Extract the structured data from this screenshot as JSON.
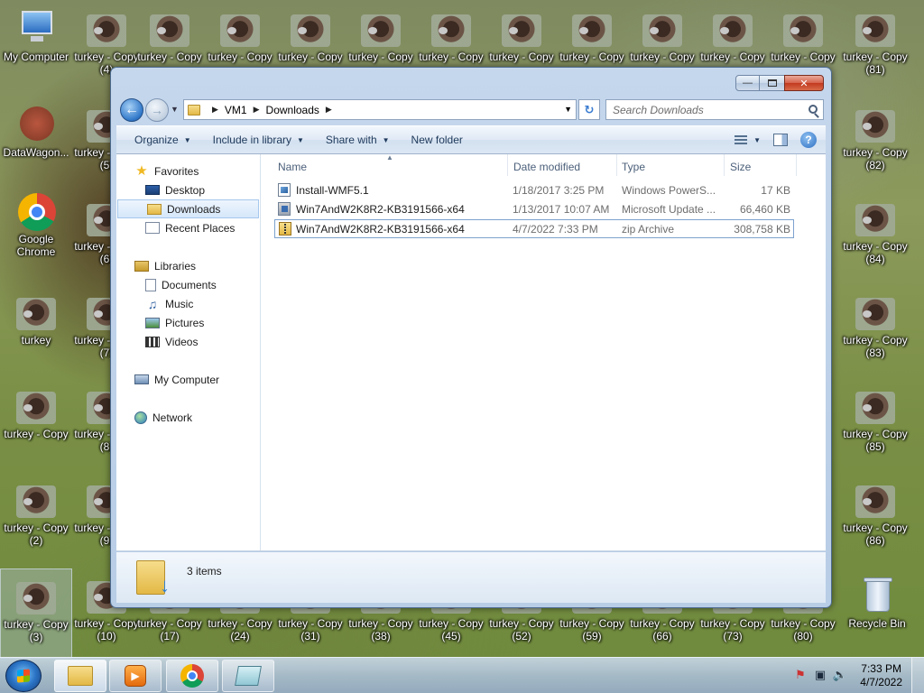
{
  "desktop": {
    "icons": [
      {
        "label": "My Computer",
        "icon": "computer-icon",
        "name": "desktop-icon-my-computer"
      },
      {
        "label": "DataWagon...",
        "icon": "datawagon-icon",
        "name": "desktop-icon-datawagon"
      },
      {
        "label": "Google Chrome",
        "icon": "chrome-icon",
        "name": "desktop-icon-google-chrome"
      },
      {
        "label": "turkey",
        "icon": "turkey-image-icon",
        "name": "desktop-icon-turkey"
      },
      {
        "label": "turkey - Copy (2)",
        "icon": "turkey-image-icon",
        "name": "desktop-icon-turkey-copy-2"
      },
      {
        "label": "turkey - Copy (3)",
        "icon": "turkey-image-icon",
        "name": "desktop-icon-turkey-copy-3"
      },
      {
        "label": "Recycle Bin",
        "icon": "recycle-bin-icon",
        "name": "desktop-icon-recycle-bin"
      }
    ],
    "turkey_copy_labels": {
      "top_row": [
        "turkey - Copy (4)",
        "turkey - Copy",
        "turkey - Copy",
        "turkey - Copy",
        "turkey - Copy",
        "turkey - Copy",
        "turkey - Copy",
        "turkey - Copy",
        "turkey - Copy",
        "turkey - Copy",
        "turkey - Copy",
        "turkey - Copy (81)",
        "turkey - Copy"
      ],
      "column_two": [
        "turkey - Copy (5)",
        "turkey - Copy (6)",
        "turkey - Copy (7)",
        "turkey - Copy (8)",
        "turkey - Copy (9)",
        "turkey - Copy (10)"
      ],
      "right_column": [
        "turkey - Copy (82)",
        "turkey - Copy (84)",
        "turkey - Copy (83)",
        "turkey - Copy (85)",
        "turkey - Copy (86)"
      ],
      "bottom_row": [
        "turkey - Copy (17)",
        "turkey - Copy (24)",
        "turkey - Copy (31)",
        "turkey - Copy (38)",
        "turkey - Copy (45)",
        "turkey - Copy (52)",
        "turkey - Copy (59)",
        "turkey - Copy (66)",
        "turkey - Copy (73)",
        "turkey - Copy (80)"
      ],
      "bottom_row_visible": [
        {
          "l1": "turkey - Copy",
          "l2": "(17)"
        },
        {
          "l1": "turkey - Copy",
          "l2": "(24)"
        },
        {
          "l1": "turkey - Copy",
          "l2": "(31)"
        },
        {
          "l1": "turkey - Copy",
          "l2": "(38)"
        },
        {
          "l1": "turkey - Copy",
          "l2": "(45)"
        },
        {
          "l1": "turkey - Copy",
          "l2": "(52)"
        },
        {
          "l1": "turkey - Copy",
          "l2": "(59)"
        },
        {
          "l1": "turkey - Copy",
          "l2": "(66)"
        },
        {
          "l1": "turkey - Copy",
          "l2": "(73)"
        },
        {
          "l1": "turkey - Copy",
          "l2": "(80)"
        }
      ]
    }
  },
  "window": {
    "breadcrumb": [
      "VM1",
      "Downloads"
    ],
    "search_placeholder": "Search Downloads",
    "toolbar": {
      "organize": "Organize",
      "include_in_library": "Include in library",
      "share_with": "Share with",
      "new_folder": "New folder"
    },
    "nav_pane": {
      "favorites": "Favorites",
      "desktop": "Desktop",
      "downloads": "Downloads",
      "recent_places": "Recent Places",
      "libraries": "Libraries",
      "documents": "Documents",
      "music": "Music",
      "pictures": "Pictures",
      "videos": "Videos",
      "my_computer": "My Computer",
      "network": "Network"
    },
    "columns": {
      "name": "Name",
      "date_modified": "Date modified",
      "type": "Type",
      "size": "Size"
    },
    "files": [
      {
        "name": "Install-WMF5.1",
        "date": "1/18/2017 3:25 PM",
        "type": "Windows PowerS...",
        "size": "17 KB",
        "icon": "powershell-script-icon"
      },
      {
        "name": "Win7AndW2K8R2-KB3191566-x64",
        "date": "1/13/2017 10:07 AM",
        "type": "Microsoft Update ...",
        "size": "66,460 KB",
        "icon": "msu-update-icon"
      },
      {
        "name": "Win7AndW2K8R2-KB3191566-x64",
        "date": "4/7/2022 7:33 PM",
        "type": "zip Archive",
        "size": "308,758 KB",
        "icon": "zip-archive-icon"
      }
    ],
    "status": {
      "items": "3 items"
    }
  },
  "taskbar": {
    "pinned": [
      {
        "name": "taskbar-explorer",
        "icon": "folder-icon"
      },
      {
        "name": "taskbar-media-player",
        "icon": "media-player-icon"
      },
      {
        "name": "taskbar-chrome",
        "icon": "chrome-icon"
      },
      {
        "name": "taskbar-notepad",
        "icon": "notepad-icon"
      }
    ],
    "clock": {
      "time": "7:33 PM",
      "date": "4/7/2022"
    }
  },
  "colors": {
    "accent": "#2f77c9",
    "selection_border": "#7da2ce"
  }
}
